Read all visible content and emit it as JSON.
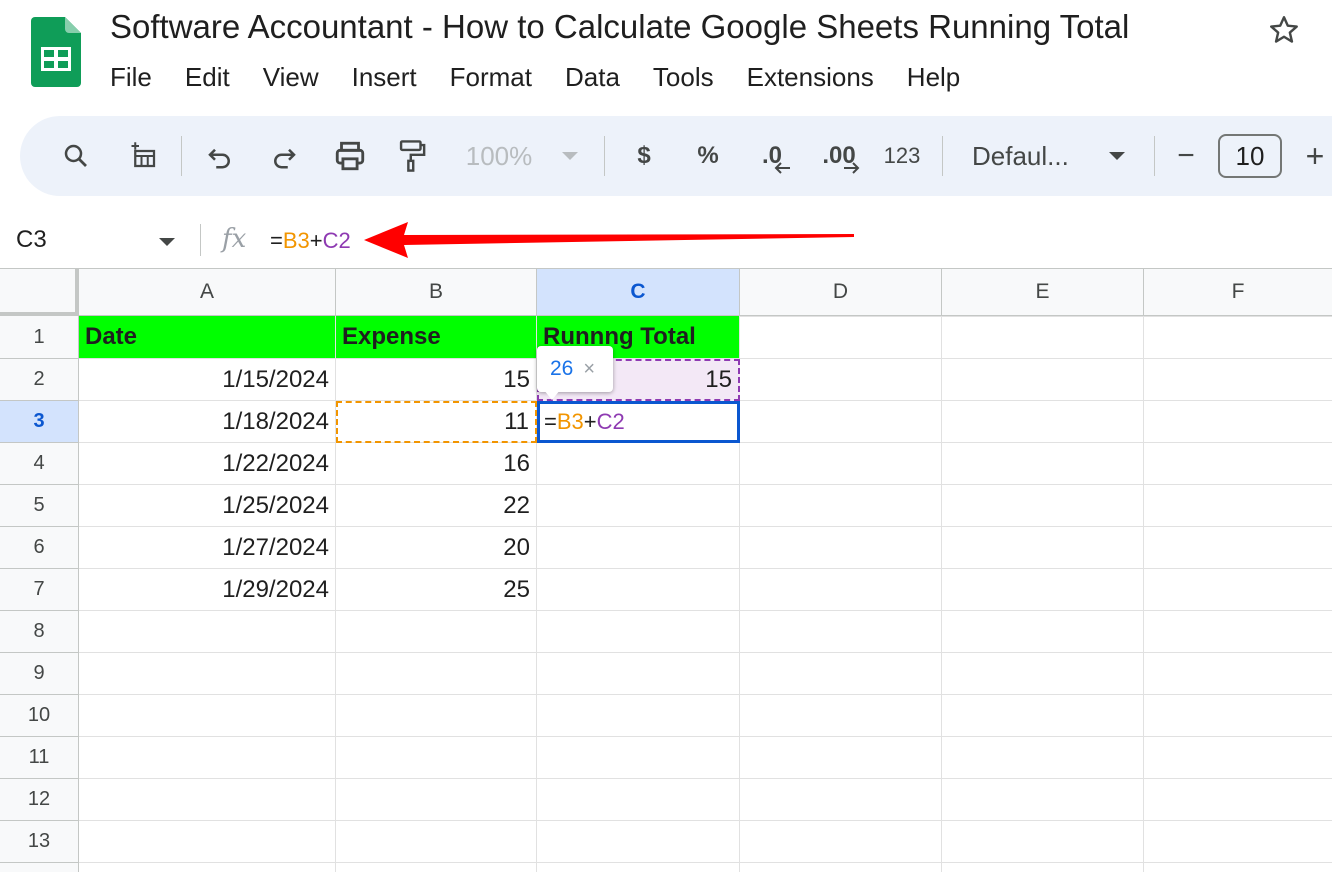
{
  "app": {
    "title": "Software Accountant - How to Calculate Google Sheets Running Total",
    "star_icon": "star-icon"
  },
  "menu": [
    "File",
    "Edit",
    "View",
    "Insert",
    "Format",
    "Data",
    "Tools",
    "Extensions",
    "Help"
  ],
  "toolbar": {
    "zoom": "100%",
    "currency": "$",
    "percent": "%",
    "decrease_decimal": ".0",
    "increase_decimal": ".00",
    "number_format": "123",
    "font": "Defaul...",
    "font_size": "10",
    "minus": "−",
    "plus": "+"
  },
  "formula_bar": {
    "name_box": "C3",
    "fx": "fx",
    "formula_eq": "=",
    "formula_ref1": "B3",
    "formula_op": "+",
    "formula_ref2": "C2"
  },
  "columns": [
    "A",
    "B",
    "C",
    "D",
    "E",
    "F"
  ],
  "rows": [
    "1",
    "2",
    "3",
    "4",
    "5",
    "6",
    "7",
    "8",
    "9",
    "10",
    "11",
    "12",
    "13"
  ],
  "sheet": {
    "headers": [
      "Date",
      "Expense",
      "Runnng Total"
    ],
    "data": [
      {
        "date": "1/15/2024",
        "expense": "15",
        "total": "15"
      },
      {
        "date": "1/18/2024",
        "expense": "11",
        "total": ""
      },
      {
        "date": "1/22/2024",
        "expense": "16",
        "total": ""
      },
      {
        "date": "1/25/2024",
        "expense": "22",
        "total": ""
      },
      {
        "date": "1/27/2024",
        "expense": "20",
        "total": ""
      },
      {
        "date": "1/29/2024",
        "expense": "25",
        "total": ""
      }
    ],
    "editing_cell": {
      "eq": "=",
      "ref1": "B3",
      "op": "+",
      "ref2": "C2"
    },
    "preview_value": "26",
    "preview_close": "×"
  },
  "colors": {
    "header_fill": "#00ff00",
    "ref_b": "#f29500",
    "ref_c": "#8e3ab2",
    "selection": "#0b57d0",
    "annotation_arrow": "#ff0000"
  }
}
